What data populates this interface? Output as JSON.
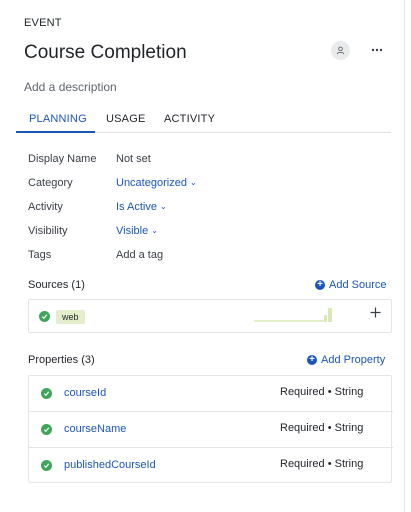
{
  "header": {
    "event_label": "EVENT",
    "title": "Course Completion",
    "description_placeholder": "Add a description"
  },
  "tabs": [
    {
      "label": "PLANNING",
      "active": true
    },
    {
      "label": "USAGE",
      "active": false
    },
    {
      "label": "ACTIVITY",
      "active": false
    }
  ],
  "details": {
    "display_name": {
      "key": "Display Name",
      "value": "Not set"
    },
    "category": {
      "key": "Category",
      "value": "Uncategorized"
    },
    "activity": {
      "key": "Activity",
      "value": "Is Active"
    },
    "visibility": {
      "key": "Visibility",
      "value": "Visible"
    },
    "tags": {
      "key": "Tags",
      "value": "Add a tag"
    }
  },
  "sources": {
    "title": "Sources (1)",
    "add_label": "Add Source",
    "items": [
      {
        "name": "web",
        "status": "ok"
      }
    ]
  },
  "properties": {
    "title": "Properties (3)",
    "add_label": "Add Property",
    "items": [
      {
        "name": "courseId",
        "meta": "Required • String"
      },
      {
        "name": "courseName",
        "meta": "Required • String"
      },
      {
        "name": "publishedCourseId",
        "meta": "Required • String"
      }
    ]
  },
  "colors": {
    "accent": "#1a56b8",
    "success": "#3fa55a",
    "tag_bg": "#e3eecd"
  },
  "icons": {
    "avatar": "user-icon",
    "more": "more-horizontal-icon",
    "check": "check-circle-icon",
    "add": "plus-icon"
  }
}
